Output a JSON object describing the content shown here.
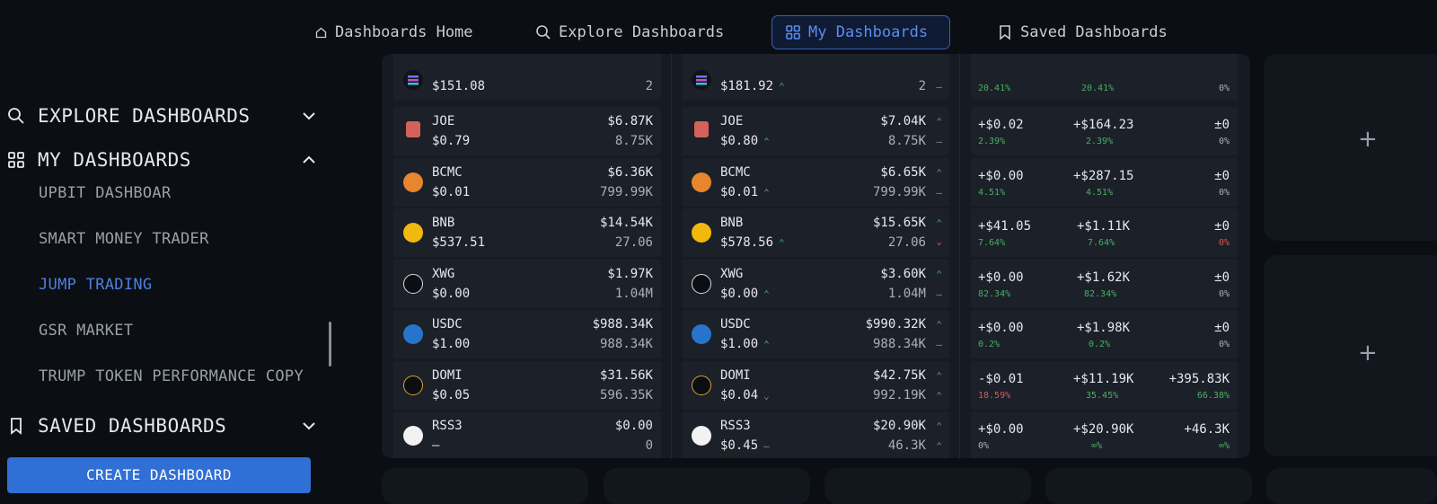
{
  "nav": {
    "home": "Dashboards Home",
    "explore": "Explore Dashboards",
    "my": "My Dashboards",
    "saved": "Saved Dashboards"
  },
  "sidebar": {
    "explore": "EXPLORE DASHBOARDS",
    "my": "MY DASHBOARDS",
    "items": [
      "UPBIT DASHBOAR",
      "SMART MONEY TRADER",
      "JUMP TRADING",
      "GSR MARKET",
      "TRUMP TOKEN PERFORMANCE COPY"
    ],
    "saved": "SAVED DASHBOARDS",
    "create": "CREATE DASHBOARD"
  },
  "col1": [
    {
      "sym": "",
      "price": "$151.08",
      "val": "",
      "qty": "2"
    },
    {
      "sym": "JOE",
      "price": "$0.79",
      "val": "$6.87K",
      "qty": "8.75K"
    },
    {
      "sym": "BCMC",
      "price": "$0.01",
      "val": "$6.36K",
      "qty": "799.99K"
    },
    {
      "sym": "BNB",
      "price": "$537.51",
      "val": "$14.54K",
      "qty": "27.06"
    },
    {
      "sym": "XWG",
      "price": "$0.00",
      "val": "$1.97K",
      "qty": "1.04M"
    },
    {
      "sym": "USDC",
      "price": "$1.00",
      "val": "$988.34K",
      "qty": "988.34K"
    },
    {
      "sym": "DOMI",
      "price": "$0.05",
      "val": "$31.56K",
      "qty": "596.35K"
    },
    {
      "sym": "RSS3",
      "price": "—",
      "val": "$0.00",
      "qty": "0"
    }
  ],
  "col2": [
    {
      "sym": "",
      "price": "$181.92",
      "val": "",
      "qty": "2"
    },
    {
      "sym": "JOE",
      "price": "$0.80",
      "val": "$7.04K",
      "qty": "8.75K"
    },
    {
      "sym": "BCMC",
      "price": "$0.01",
      "val": "$6.65K",
      "qty": "799.99K"
    },
    {
      "sym": "BNB",
      "price": "$578.56",
      "val": "$15.65K",
      "qty": "27.06"
    },
    {
      "sym": "XWG",
      "price": "$0.00",
      "val": "$3.60K",
      "qty": "1.04M"
    },
    {
      "sym": "USDC",
      "price": "$1.00",
      "val": "$990.32K",
      "qty": "988.34K"
    },
    {
      "sym": "DOMI",
      "price": "$0.04",
      "val": "$42.75K",
      "qty": "992.19K"
    },
    {
      "sym": "RSS3",
      "price": "$0.45",
      "val": "$20.90K",
      "qty": "46.3K"
    }
  ],
  "col3": [
    {
      "a": "",
      "ap": "20.41%",
      "b": "",
      "bp": "20.41%",
      "c": "",
      "cp": "0%"
    },
    {
      "a": "+$0.02",
      "ap": "2.39%",
      "b": "+$164.23",
      "bp": "2.39%",
      "c": "±0",
      "cp": "0%"
    },
    {
      "a": "+$0.00",
      "ap": "4.51%",
      "b": "+$287.15",
      "bp": "4.51%",
      "c": "±0",
      "cp": "0%"
    },
    {
      "a": "+$41.05",
      "ap": "7.64%",
      "b": "+$1.11K",
      "bp": "7.64%",
      "c": "±0",
      "cp": "0%"
    },
    {
      "a": "+$0.00",
      "ap": "82.34%",
      "b": "+$1.62K",
      "bp": "82.34%",
      "c": "±0",
      "cp": "0%"
    },
    {
      "a": "+$0.00",
      "ap": "0.2%",
      "b": "+$1.98K",
      "bp": "0.2%",
      "c": "±0",
      "cp": "0%"
    },
    {
      "a": "-$0.01",
      "ap": "18.59%",
      "b": "+$11.19K",
      "bp": "35.45%",
      "c": "+395.83K",
      "cp": "66.38%"
    },
    {
      "a": "+$0.00",
      "ap": "0%",
      "b": "+$20.90K",
      "bp": "∞%",
      "c": "+46.3K",
      "cp": "∞%"
    }
  ],
  "plus": "+"
}
